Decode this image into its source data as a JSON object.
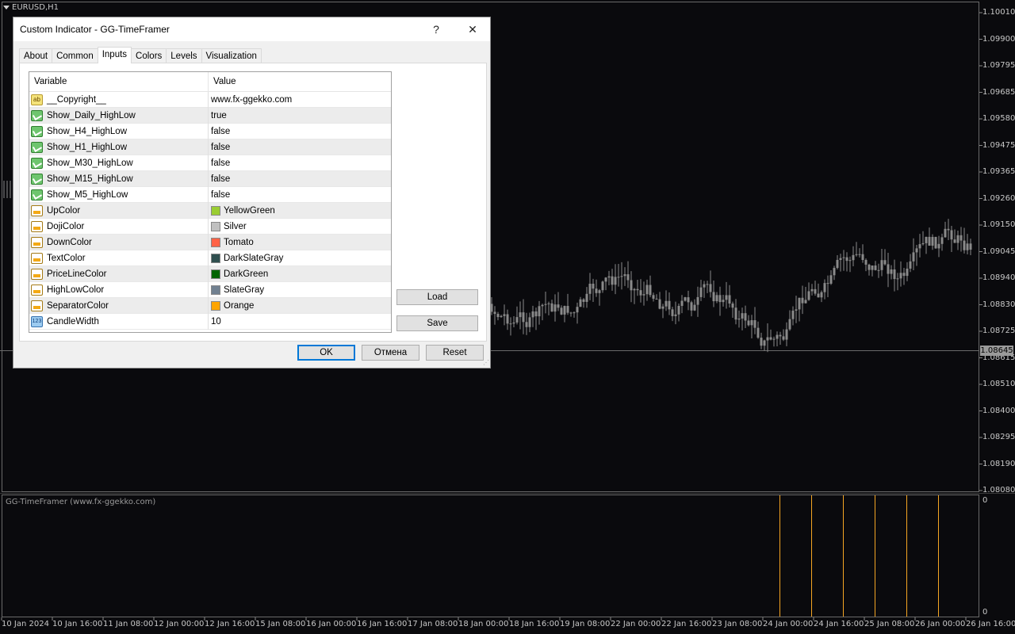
{
  "chart": {
    "symbol": "EURUSD,H1",
    "current_price": "1.08645",
    "price_ticks": [
      "1.10010",
      "1.09900",
      "1.09795",
      "1.09685",
      "1.09580",
      "1.09475",
      "1.09365",
      "1.09260",
      "1.09150",
      "1.09045",
      "1.08940",
      "1.08830",
      "1.08725",
      "1.08615",
      "1.08510",
      "1.08400",
      "1.08295",
      "1.08190",
      "1.08080"
    ],
    "time_ticks": [
      "10 Jan 2024",
      "10 Jan 16:00",
      "11 Jan 08:00",
      "12 Jan 00:00",
      "12 Jan 16:00",
      "15 Jan 08:00",
      "16 Jan 00:00",
      "16 Jan 16:00",
      "17 Jan 08:00",
      "18 Jan 00:00",
      "18 Jan 16:00",
      "19 Jan 08:00",
      "22 Jan 00:00",
      "22 Jan 16:00",
      "23 Jan 08:00",
      "24 Jan 00:00",
      "24 Jan 16:00",
      "25 Jan 08:00",
      "26 Jan 00:00",
      "26 Jan 16:00"
    ],
    "indicator_label": "GG-TimeFramer (www.fx-ggekko.com)",
    "indicator_scale": [
      "0",
      "0"
    ],
    "colors": {
      "candle": "#8a8a8a",
      "separator": "#f5a623",
      "price_line": "#6a6a6a",
      "background": "#0a0a0d"
    }
  },
  "dialog": {
    "title": "Custom Indicator - GG-TimeFramer",
    "help_label": "?",
    "close_label": "✕",
    "tabs": [
      "About",
      "Common",
      "Inputs",
      "Colors",
      "Levels",
      "Visualization"
    ],
    "active_tab": "Inputs",
    "headers": {
      "variable": "Variable",
      "value": "Value"
    },
    "rows": [
      {
        "icon": "ab",
        "icon_text": "ab",
        "name": "__Copyright__",
        "value": "www.fx-ggekko.com"
      },
      {
        "icon": "bool",
        "name": "Show_Daily_HighLow",
        "value": "true"
      },
      {
        "icon": "bool",
        "name": "Show_H4_HighLow",
        "value": "false"
      },
      {
        "icon": "bool",
        "name": "Show_H1_HighLow",
        "value": "false"
      },
      {
        "icon": "bool",
        "name": "Show_M30_HighLow",
        "value": "false"
      },
      {
        "icon": "bool",
        "name": "Show_M15_HighLow",
        "value": "false"
      },
      {
        "icon": "bool",
        "name": "Show_M5_HighLow",
        "value": "false"
      },
      {
        "icon": "color",
        "name": "UpColor",
        "value": "YellowGreen",
        "swatch": "#9acd32"
      },
      {
        "icon": "color",
        "name": "DojiColor",
        "value": "Silver",
        "swatch": "#c0c0c0"
      },
      {
        "icon": "color",
        "name": "DownColor",
        "value": "Tomato",
        "swatch": "#ff6347"
      },
      {
        "icon": "color",
        "name": "TextColor",
        "value": "DarkSlateGray",
        "swatch": "#2f4f4f"
      },
      {
        "icon": "color",
        "name": "PriceLineColor",
        "value": "DarkGreen",
        "swatch": "#006400"
      },
      {
        "icon": "color",
        "name": "HighLowColor",
        "value": "SlateGray",
        "swatch": "#708090"
      },
      {
        "icon": "color",
        "name": "SeparatorColor",
        "value": "Orange",
        "swatch": "#ffa500"
      },
      {
        "icon": "num",
        "icon_text": "123",
        "name": "CandleWidth",
        "value": "10"
      }
    ],
    "buttons": {
      "load": "Load",
      "save": "Save",
      "ok": "OK",
      "cancel": "Отмена",
      "reset": "Reset"
    }
  }
}
